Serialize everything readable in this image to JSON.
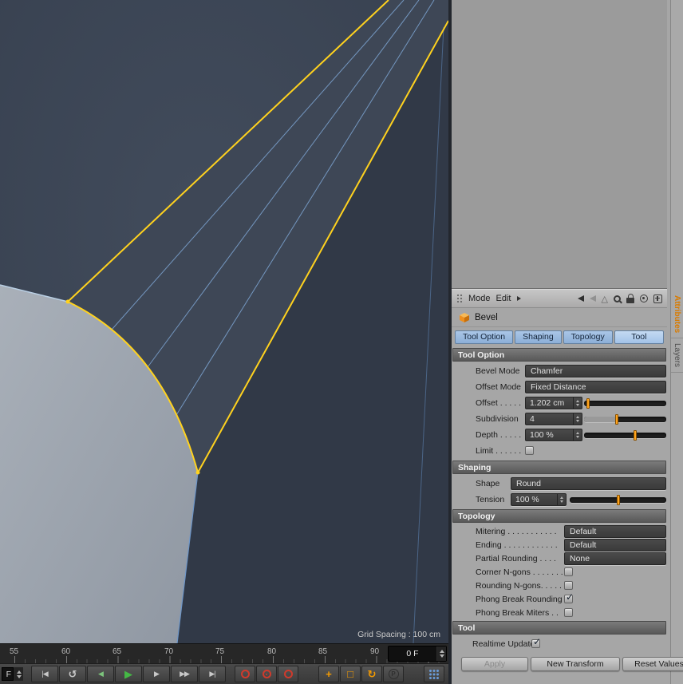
{
  "viewport": {
    "grid_spacing": "Grid Spacing : 100 cm"
  },
  "timeline": {
    "labels": [
      "55",
      "60",
      "65",
      "70",
      "75",
      "80",
      "85",
      "90"
    ],
    "frame_field": "0 F"
  },
  "transport": {
    "frame_label": "F",
    "play_color": "#45b945",
    "play_backwards_color": "#7cc47c",
    "buttons": [
      {
        "name": "goto-start",
        "glyph": "|◀"
      },
      {
        "name": "loop",
        "glyph": "↺"
      },
      {
        "name": "play-backwards",
        "glyph": "◀"
      },
      {
        "name": "play",
        "glyph": "▶"
      },
      {
        "name": "next-frame",
        "glyph": "▶"
      },
      {
        "name": "fast-forward",
        "glyph": "▶▶"
      },
      {
        "name": "goto-end",
        "glyph": "▶|"
      }
    ],
    "toggles": [
      {
        "name": "record-position",
        "glyph": "+",
        "color": "#f59b00"
      },
      {
        "name": "record-scale",
        "glyph": "□",
        "color": "#f59b00"
      },
      {
        "name": "record-rotation",
        "glyph": "↻",
        "color": "#f59b00"
      },
      {
        "name": "record-parameter",
        "glyph": "P",
        "color": "#2e2e2e"
      }
    ]
  },
  "attributes_panel": {
    "mode_bar": {
      "mode_label": "Mode",
      "edit_label": "Edit"
    },
    "object_name": "Bevel",
    "tabs": [
      {
        "label": "Tool Option"
      },
      {
        "label": "Shaping"
      },
      {
        "label": "Topology"
      },
      {
        "label": "Tool"
      }
    ],
    "tool_option": {
      "title": "Tool Option",
      "bevel_mode": {
        "label": "Bevel Mode",
        "value": "Chamfer"
      },
      "offset_mode": {
        "label": "Offset Mode",
        "value": "Fixed Distance"
      },
      "offset": {
        "label": "Offset . . . . .",
        "value": "1.202 cm",
        "slider_pos": "5%"
      },
      "subdivision": {
        "label": "Subdivision",
        "value": "4",
        "slider_pos": "40%",
        "fill_width": "40%"
      },
      "depth": {
        "label": "Depth . . . . .",
        "value": "100 %",
        "slider_pos": "62%"
      },
      "limit": {
        "label": "Limit . . . . . .",
        "check": ""
      }
    },
    "shaping": {
      "title": "Shaping",
      "shape": {
        "label": "Shape",
        "value": "Round"
      },
      "tension": {
        "label": "Tension",
        "value": "100 %",
        "slider_pos": "50%"
      }
    },
    "topology": {
      "title": "Topology",
      "mitering": {
        "label": "Mitering . . . . . . . . . . .",
        "value": "Default"
      },
      "ending": {
        "label": "Ending . . . . . . . . . . . .",
        "value": "Default"
      },
      "partial_rounding": {
        "label": "Partial Rounding . . . .",
        "value": "None"
      },
      "corner_ngons": {
        "label": "Corner N-gons . . . . . . .",
        "check": ""
      },
      "rounding_ngons": {
        "label": "Rounding N-gons. . . . .",
        "check": ""
      },
      "phong_break_rounding": {
        "label": "Phong Break Rounding",
        "check": "✓"
      },
      "phong_break_miters": {
        "label": "Phong Break Miters . .",
        "check": ""
      }
    },
    "tool": {
      "title": "Tool",
      "realtime_update": {
        "label": "Realtime Update",
        "check": "✓"
      },
      "buttons": [
        {
          "label": "Apply"
        },
        {
          "label": "New Transform"
        },
        {
          "label": "Reset Values"
        }
      ]
    },
    "side_tabs": [
      {
        "label": "Attributes",
        "color": "#d97b00"
      },
      {
        "label": "Layers",
        "color": "#4c4c4c"
      }
    ]
  }
}
